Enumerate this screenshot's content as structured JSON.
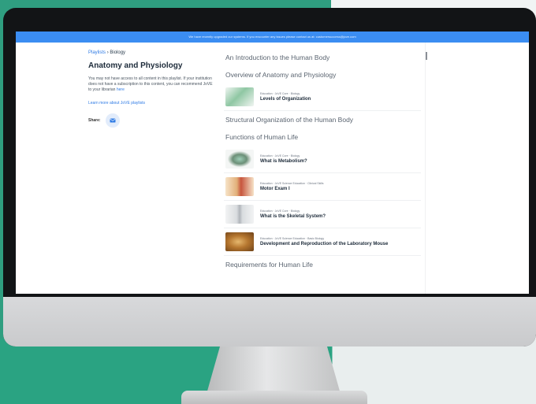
{
  "banner": "We have recently upgraded our systems. If you encounter any issues please contact us at: customersuccess@jove.com",
  "breadcrumb": {
    "link": "Playlists",
    "sep": "›",
    "current": "Biology"
  },
  "title": "Anatomy and Physiology",
  "notice": {
    "text": "You may not have access to all content in this playlist. If your institution does not have a subscription to this content, you can recommend JoVE to your librarian ",
    "link": "here"
  },
  "learn_more": "Learn more about JoVE playlists",
  "share_label": "Share:",
  "sections": [
    {
      "heading": "An Introduction to the Human Body",
      "items": []
    },
    {
      "heading": "Overview of Anatomy and Physiology",
      "items": [
        {
          "tags": "Education · JoVE Core · Biology",
          "title": "Levels of Organization",
          "thumb_color": "#8fc7a3"
        }
      ]
    },
    {
      "heading": "Structural Organization of the Human Body",
      "items": []
    },
    {
      "heading": "Functions of Human Life",
      "items": [
        {
          "tags": "Education · JoVE Core · Biology",
          "title": "What is Metabolism?",
          "thumb_color": "#9ecfb8"
        },
        {
          "tags": "Education · JoVE Science Education · Clinical Skills",
          "title": "Motor Exam I",
          "thumb_color": "#e2b07a"
        },
        {
          "tags": "Education · JoVE Core · Biology",
          "title": "What is the Skeletal System?",
          "thumb_color": "#d9dcdf"
        },
        {
          "tags": "Education · JoVE Science Education · Basic Biology",
          "title": "Development and Reproduction of the Laboratory Mouse",
          "thumb_color": "#b5762f"
        }
      ]
    },
    {
      "heading": "Requirements for Human Life",
      "items": []
    }
  ],
  "colors": {
    "banner": "#3b8df2",
    "link": "#2f7be5"
  }
}
